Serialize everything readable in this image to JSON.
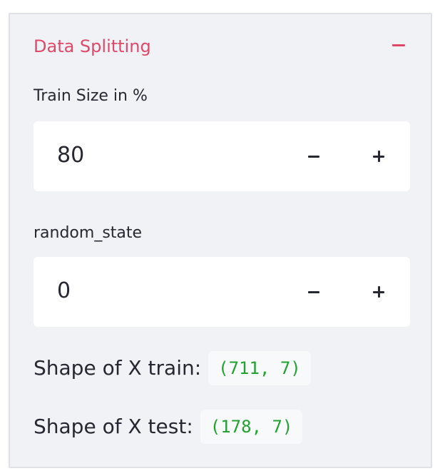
{
  "expander": {
    "title": "Data Splitting"
  },
  "train_size": {
    "label": "Train Size in %",
    "value": "80"
  },
  "random_state": {
    "label": "random_state",
    "value": "0"
  },
  "shapes": {
    "train_label": "Shape of X train:",
    "train_value": "(711, 7)",
    "test_label": "Shape of X test:",
    "test_value": "(178, 7)"
  },
  "colors": {
    "accent": "#e0486a",
    "panel_bg": "#f0f2f6",
    "code_green": "#22a131",
    "text": "#262730"
  }
}
